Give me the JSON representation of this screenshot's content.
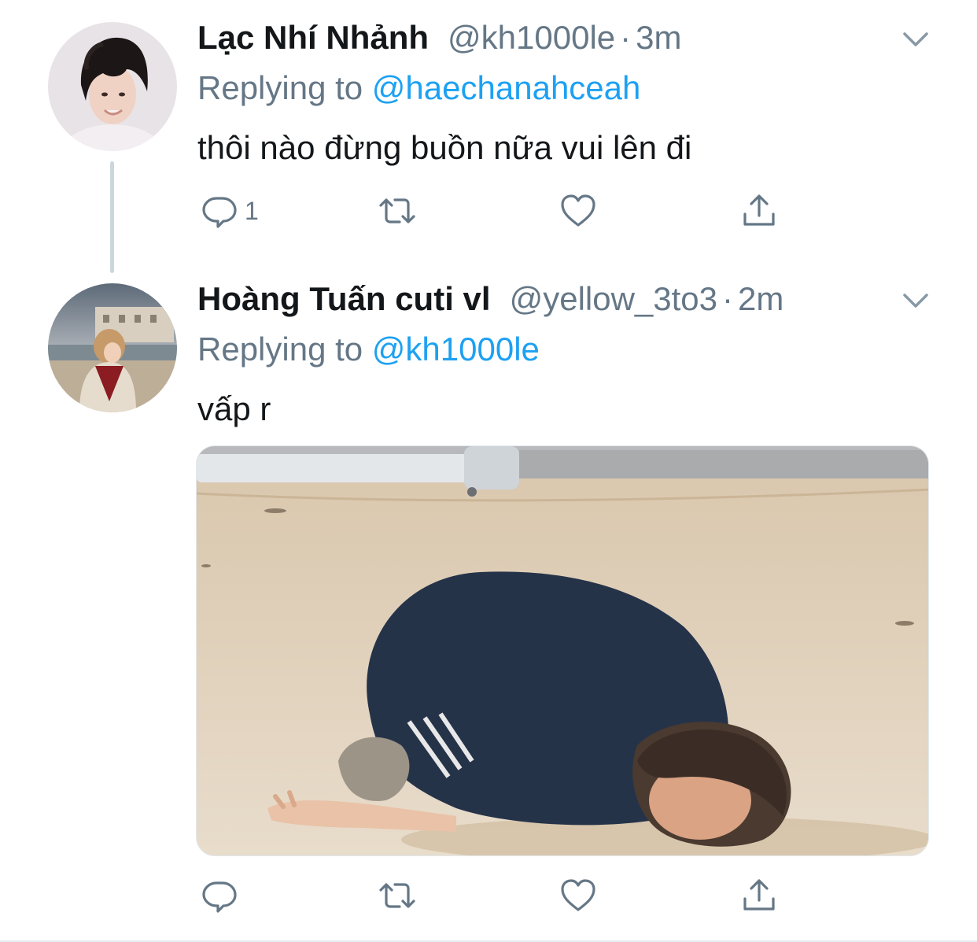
{
  "tweets": [
    {
      "display_name": "Lạc Nhí Nhảnh",
      "handle": "@kh1000le",
      "separator": "·",
      "time": "3m",
      "replying_prefix": "Replying to",
      "replying_to": "@haechanahceah",
      "text": "thôi nào đừng buồn nữa vui lên đi",
      "reply_count": "1",
      "avatar": "avatar-photo-young-man",
      "icons": [
        "reply-icon",
        "retweet-icon",
        "like-icon",
        "share-icon",
        "chevron-down-icon"
      ]
    },
    {
      "display_name": "Hoàng Tuấn cuti vl",
      "handle": "@yellow_3to3",
      "separator": "·",
      "time": "2m",
      "replying_prefix": "Replying to",
      "replying_to": "@kh1000le",
      "text": "vấp r",
      "reply_count": "",
      "avatar": "avatar-photo-person-at-beach",
      "media": "photo-person-bowing-on-floor",
      "icons": [
        "reply-icon",
        "retweet-icon",
        "like-icon",
        "share-icon",
        "chevron-down-icon"
      ]
    }
  ],
  "colors": {
    "text_primary": "#14171a",
    "text_secondary": "#657786",
    "link": "#1da1f2",
    "thread_line": "#ccd6dd",
    "divider": "#e6ecf0"
  }
}
